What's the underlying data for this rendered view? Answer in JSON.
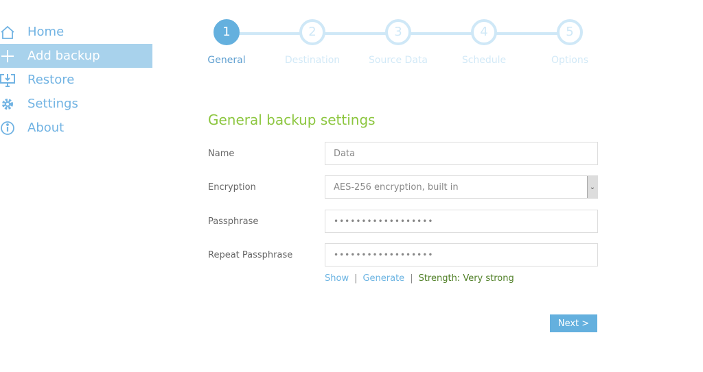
{
  "sidebar": {
    "items": [
      {
        "label": "Home",
        "icon": "home-icon"
      },
      {
        "label": "Add backup",
        "icon": "plus-icon",
        "active": true
      },
      {
        "label": "Restore",
        "icon": "restore-icon"
      },
      {
        "label": "Settings",
        "icon": "gear-icon"
      },
      {
        "label": "About",
        "icon": "info-icon"
      }
    ]
  },
  "wizard": {
    "current_step": 1,
    "steps": [
      {
        "number": "1",
        "label": "General"
      },
      {
        "number": "2",
        "label": "Destination"
      },
      {
        "number": "3",
        "label": "Source Data"
      },
      {
        "number": "4",
        "label": "Schedule"
      },
      {
        "number": "5",
        "label": "Options"
      }
    ]
  },
  "form": {
    "title": "General backup settings",
    "name_label": "Name",
    "name_value": "Data",
    "encryption_label": "Encryption",
    "encryption_value": "AES-256 encryption, built in",
    "passphrase_label": "Passphrase",
    "passphrase_value": "••••••••••••••••••",
    "repeat_label": "Repeat Passphrase",
    "repeat_value": "••••••••••••••••••",
    "show_link": "Show",
    "generate_link": "Generate",
    "separator": "|",
    "strength": "Strength: Very strong",
    "next_label": "Next >"
  },
  "colors": {
    "accent": "#64b0de",
    "title_green": "#8cc63f",
    "strength_green": "#4f7f26"
  }
}
